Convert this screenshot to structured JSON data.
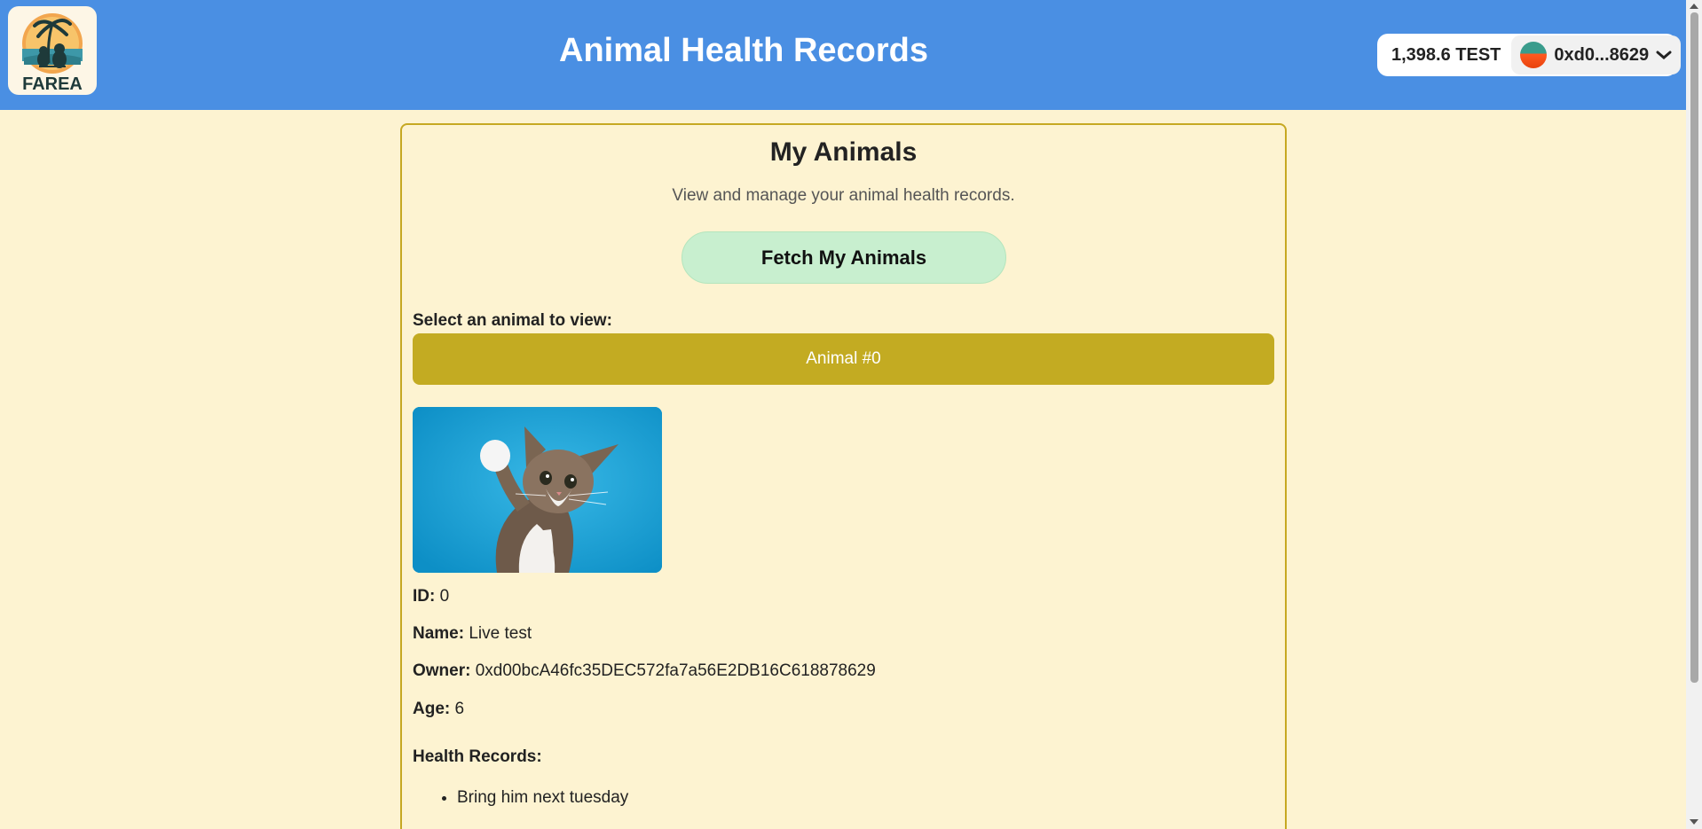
{
  "header": {
    "logo_text": "FAREA",
    "title": "Animal Health Records",
    "wallet": {
      "balance": "1,398.6 TEST",
      "address": "0xd0...8629",
      "chevron": "❯"
    }
  },
  "main": {
    "title": "My Animals",
    "subtitle": "View and manage your animal health records.",
    "fetch_button": "Fetch My Animals",
    "select_label": "Select an animal to view:",
    "selected_animal": "Animal #0",
    "photo_icon": "cat-photo",
    "details": {
      "id_label": "ID:",
      "id_value": "0",
      "name_label": "Name:",
      "name_value": "Live test",
      "owner_label": "Owner:",
      "owner_value": "0xd00bcA46fc35DEC572fa7a56E2DB16C618878629",
      "age_label": "Age:",
      "age_value": "6"
    },
    "health_records_title": "Health Records:",
    "health_records": [
      "Bring him next tuesday"
    ]
  },
  "colors": {
    "header_bg": "#4a8fe3",
    "page_bg": "#fdf3d1",
    "card_border": "#c6a822",
    "select_bg": "#c3ab22",
    "fetch_bg": "#c8efcf"
  }
}
